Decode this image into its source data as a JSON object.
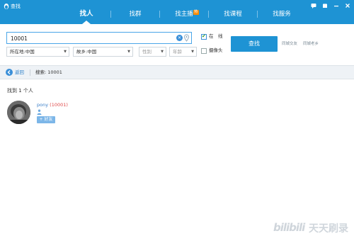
{
  "window": {
    "title": "查找",
    "controls": [
      "message-icon",
      "skin-icon",
      "minimize-icon",
      "close-icon"
    ]
  },
  "tabs": [
    {
      "label": "找人",
      "active": true
    },
    {
      "label": "找群",
      "active": false
    },
    {
      "label": "找主播",
      "active": false,
      "badge": "热"
    },
    {
      "label": "找课程",
      "active": false
    },
    {
      "label": "找服务",
      "active": false
    }
  ],
  "search": {
    "value": "10001",
    "placeholder": "",
    "location_select": "所在地:中国",
    "hometown_select": "故乡:中国",
    "gender_select": "性别",
    "age_select": "年龄",
    "online_label": "在　线",
    "online_checked": true,
    "camera_label": "摄像头",
    "camera_checked": false,
    "button_label": "查找",
    "link_same_city": "同城交友",
    "link_same_hometown": "同城老乡"
  },
  "breadcrumb": {
    "back_label": "返回",
    "query_text": "搜索:  10001"
  },
  "results": {
    "count_text": "找到 1 个人",
    "items": [
      {
        "nick": "pony",
        "qq": "(10001)",
        "add_label": "+ 好友"
      }
    ]
  },
  "watermark": {
    "logo": "bilibili",
    "text": "天天刷录"
  },
  "colors": {
    "primary": "#1e93d4",
    "link": "#3a7fc8",
    "qq_number": "#e04848",
    "checkbox_check": "#2a9b2a"
  }
}
